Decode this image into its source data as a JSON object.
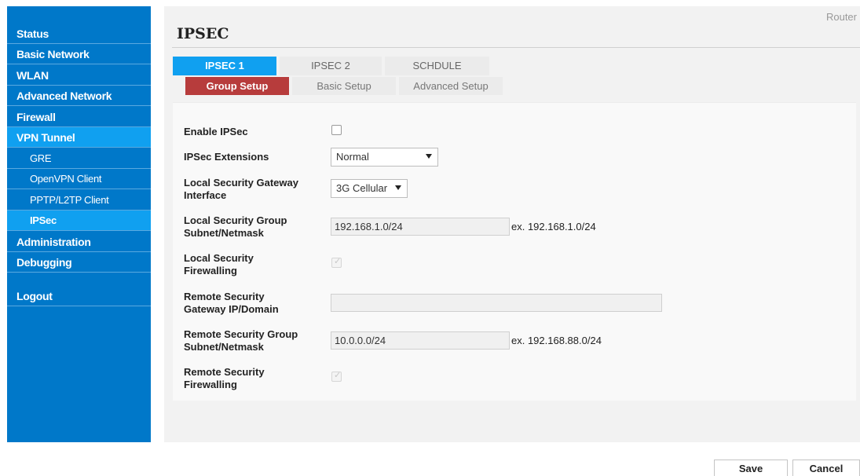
{
  "sidebar": {
    "items": [
      {
        "label": "Status"
      },
      {
        "label": "Basic Network"
      },
      {
        "label": "WLAN"
      },
      {
        "label": "Advanced Network"
      },
      {
        "label": "Firewall"
      },
      {
        "label": "VPN Tunnel",
        "active": true
      },
      {
        "label": "GRE"
      },
      {
        "label": "OpenVPN Client"
      },
      {
        "label": "PPTP/L2TP Client"
      },
      {
        "label": "IPSec",
        "active": true
      },
      {
        "label": "Administration"
      },
      {
        "label": "Debugging"
      },
      {
        "label": "Logout"
      }
    ]
  },
  "header": {
    "router_label": "Router",
    "title": "IPSEC"
  },
  "tabs": {
    "primary": [
      {
        "label": "IPSEC 1",
        "active": true
      },
      {
        "label": "IPSEC 2"
      },
      {
        "label": "SCHDULE"
      }
    ],
    "secondary": [
      {
        "label": "Group Setup",
        "active": true
      },
      {
        "label": "Basic Setup"
      },
      {
        "label": "Advanced Setup"
      }
    ]
  },
  "form": {
    "enable_ipsec": {
      "label": "Enable IPSec",
      "checked": false
    },
    "extensions": {
      "label": "IPSec Extensions",
      "value": "Normal"
    },
    "local_gateway_interface": {
      "label_line1": "Local Security Gateway",
      "label_line2": "Interface",
      "value": "3G Cellular"
    },
    "local_subnet": {
      "label_line1": "Local Security Group",
      "label_line2": "Subnet/Netmask",
      "value": "192.168.1.0/24",
      "hint": "ex. 192.168.1.0/24"
    },
    "local_firewalling": {
      "label_line1": "Local Security",
      "label_line2": "Firewalling",
      "checked": true,
      "disabled": true
    },
    "remote_gateway": {
      "label_line1": "Remote Security",
      "label_line2": "Gateway IP/Domain",
      "value": ""
    },
    "remote_subnet": {
      "label_line1": "Remote Security Group",
      "label_line2": "Subnet/Netmask",
      "value": "10.0.0.0/24",
      "hint": "ex. 192.168.88.0/24"
    },
    "remote_firewalling": {
      "label_line1": "Remote Security",
      "label_line2": "Firewalling",
      "checked": true,
      "disabled": true
    }
  },
  "buttons": {
    "save": "Save",
    "cancel": "Cancel"
  },
  "colors": {
    "sidebar_bg": "#0078c9",
    "sidebar_active": "#10a0f0",
    "subtab_active": "#b73c3c"
  }
}
